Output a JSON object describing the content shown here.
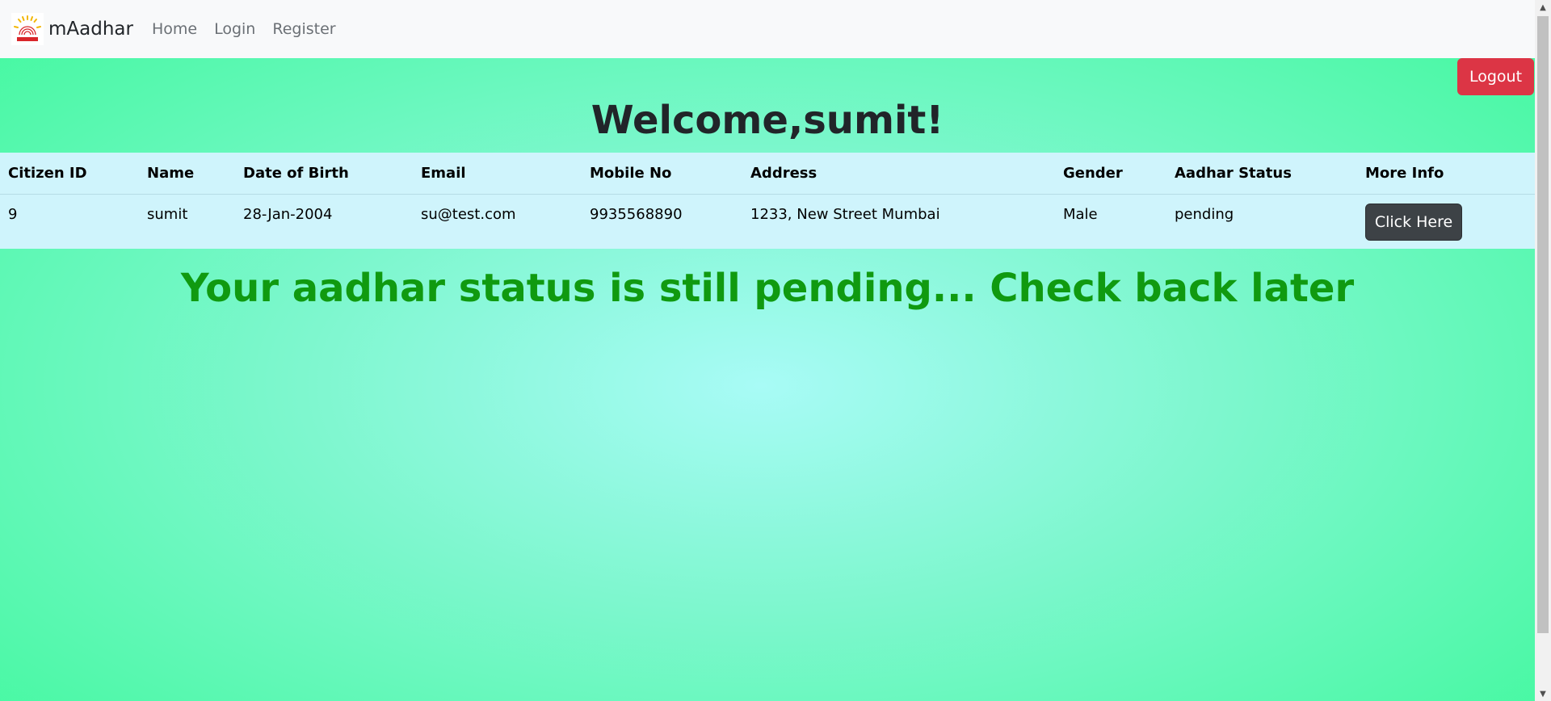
{
  "nav": {
    "brand": "mAadhar",
    "links": [
      "Home",
      "Login",
      "Register"
    ]
  },
  "logout_label": "Logout",
  "welcome": "Welcome,sumit!",
  "table": {
    "headers": [
      "Citizen ID",
      "Name",
      "Date of Birth",
      "Email",
      "Mobile No",
      "Address",
      "Gender",
      "Aadhar Status",
      "More Info"
    ],
    "rows": [
      {
        "citizen_id": "9",
        "name": "sumit",
        "dob": "28-Jan-2004",
        "email": "su@test.com",
        "mobile": "9935568890",
        "address": "1233, New Street Mumbai",
        "gender": "Male",
        "status": "pending",
        "more_info_label": "Click Here"
      }
    ]
  },
  "status_message": "Your aadhar status is still pending... Check back later",
  "colors": {
    "navbar_bg": "#f8f9fa",
    "logout_bg": "#dc3545",
    "table_bg": "#cff4fc",
    "button_dark": "#3d4246",
    "status_text": "#109a10",
    "page_gradient_edge": "#3ff99c",
    "page_gradient_center": "#a8fbf6"
  },
  "icons": {
    "logo": "aadhaar-logo-icon",
    "scroll_up": "scroll-up-arrow-icon",
    "scroll_down": "scroll-down-arrow-icon"
  }
}
